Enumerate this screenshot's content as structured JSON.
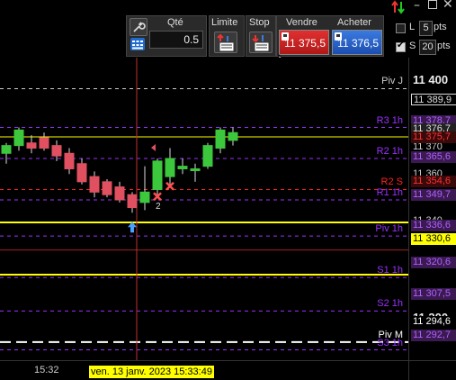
{
  "toolbar": {
    "qty_label": "Qté",
    "qty_value": "0.5",
    "limit_label": "Limite",
    "stop_label": "Stop",
    "sell_label": "Vendre",
    "buy_label": "Acheter",
    "sell_price": "11 375,5",
    "buy_price": "11 376,5",
    "l_label": "L",
    "l_value": "5",
    "l_unit": "pts",
    "s_label": "S",
    "s_value": "20",
    "s_unit": "pts",
    "s_checked": true,
    "l_checked": false
  },
  "levels": [
    {
      "name": "Piv J",
      "price": 11393,
      "color": "#cccccc",
      "style": "dash"
    },
    {
      "name": "R3 1h",
      "price": 11378,
      "color": "#9b30ff",
      "style": "dash"
    },
    {
      "name": "R2 1h",
      "price": 11366,
      "color": "#9b30ff",
      "style": "dash"
    },
    {
      "name": "R2 S",
      "price": 11354,
      "color": "#ff2020",
      "style": "dash"
    },
    {
      "name": "R1 1h",
      "price": 11350,
      "color": "#9b30ff",
      "style": "dash"
    },
    {
      "name": "Piv 1h",
      "price": 11336,
      "color": "#9b30ff",
      "style": "dash"
    },
    {
      "name": "S1 1h",
      "price": 11320,
      "color": "#9b30ff",
      "style": "dash"
    },
    {
      "name": "S2 1h",
      "price": 11307,
      "color": "#9b30ff",
      "style": "dash"
    },
    {
      "name": "Piv M",
      "price": 11295,
      "color": "#ffffff",
      "style": "longdash"
    },
    {
      "name": "S3 1h",
      "price": 11292,
      "color": "#9b30ff",
      "style": "dash"
    }
  ],
  "price_axis": {
    "ticks": [
      "11 400",
      "11 370",
      "11 360",
      "11 340",
      "11 310",
      "11 300"
    ],
    "tags": [
      {
        "text": "11 389,9",
        "bg": "#000000",
        "fg": "#dddddd",
        "border": "#dddddd"
      },
      {
        "text": "11 378,7",
        "bg": "#3a1a50",
        "fg": "#b060ff"
      },
      {
        "text": "11 376,7",
        "bg": "#222222",
        "fg": "#dddddd"
      },
      {
        "text": "11 375,7",
        "bg": "#3a0a0a",
        "fg": "#ff3030"
      },
      {
        "text": "11 365,6",
        "bg": "#3a1a50",
        "fg": "#b060ff"
      },
      {
        "text": "11 354,6",
        "bg": "#3a0a0a",
        "fg": "#ff3030"
      },
      {
        "text": "11 349,7",
        "bg": "#3a1a50",
        "fg": "#b060ff"
      },
      {
        "text": "11 336,6",
        "bg": "#3a1a50",
        "fg": "#b060ff"
      },
      {
        "text": "11 330,6",
        "bg": "#ffff00",
        "fg": "#000000"
      },
      {
        "text": "11 320,6",
        "bg": "#3a1a50",
        "fg": "#b060ff"
      },
      {
        "text": "11 307,5",
        "bg": "#3a1a50",
        "fg": "#b060ff"
      },
      {
        "text": "11 294,6",
        "bg": "#000000",
        "fg": "#ffffff"
      },
      {
        "text": "11 292,7",
        "bg": "#3a1a50",
        "fg": "#b060ff"
      }
    ]
  },
  "time_axis": {
    "tick_label": "15:32",
    "cursor_label": "ven. 13 janv. 2023 15:33:49"
  },
  "chart_data": {
    "type": "candlestick",
    "candles": [
      {
        "o": 11368,
        "h": 11372,
        "l": 11364,
        "c": 11371
      },
      {
        "o": 11371,
        "h": 11378,
        "l": 11369,
        "c": 11377
      },
      {
        "o": 11372,
        "h": 11375,
        "l": 11368,
        "c": 11370
      },
      {
        "o": 11374,
        "h": 11376,
        "l": 11369,
        "c": 11370
      },
      {
        "o": 11371,
        "h": 11373,
        "l": 11365,
        "c": 11367
      },
      {
        "o": 11368,
        "h": 11370,
        "l": 11360,
        "c": 11362
      },
      {
        "o": 11364,
        "h": 11366,
        "l": 11356,
        "c": 11357
      },
      {
        "o": 11359,
        "h": 11361,
        "l": 11351,
        "c": 11353
      },
      {
        "o": 11357,
        "h": 11358,
        "l": 11351,
        "c": 11352
      },
      {
        "o": 11355,
        "h": 11357,
        "l": 11349,
        "c": 11350
      },
      {
        "o": 11352,
        "h": 11353,
        "l": 11345,
        "c": 11347
      },
      {
        "o": 11349,
        "h": 11363,
        "l": 11346,
        "c": 11353
      },
      {
        "o": 11354,
        "h": 11366,
        "l": 11352,
        "c": 11365
      },
      {
        "o": 11359,
        "h": 11370,
        "l": 11356,
        "c": 11366
      },
      {
        "o": 11362,
        "h": 11366,
        "l": 11360,
        "c": 11363
      },
      {
        "o": 11362,
        "h": 11364,
        "l": 11357,
        "c": 11362
      },
      {
        "o": 11363,
        "h": 11372,
        "l": 11362,
        "c": 11371
      },
      {
        "o": 11370,
        "h": 11378,
        "l": 11368,
        "c": 11377
      },
      {
        "o": 11373,
        "h": 11378,
        "l": 11371,
        "c": 11376
      }
    ],
    "price_min": 11288,
    "price_max": 11405,
    "current_price": 11330.6,
    "markers": [
      {
        "type": "buy-arrow",
        "candle": 10
      },
      {
        "type": "exit-x",
        "candle": 12,
        "label": "2"
      },
      {
        "type": "exit-x",
        "candle": 13
      }
    ]
  }
}
